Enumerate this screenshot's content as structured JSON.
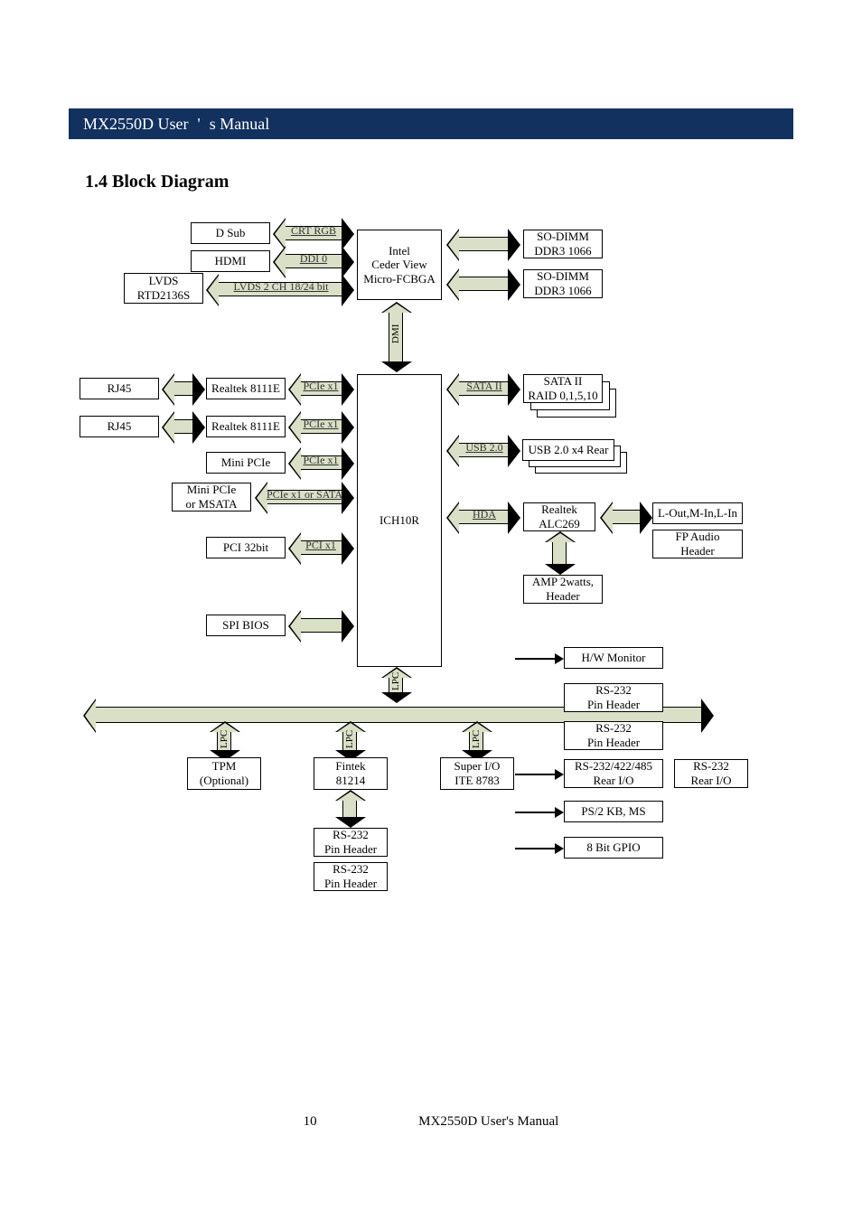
{
  "title_bar": {
    "left": "MX2550D User",
    "sep": "'",
    "right": "s Manual"
  },
  "heading": "1.4 Block Diagram",
  "footer": "MX2550D User's Manual",
  "cpu": {
    "l1": "Intel",
    "l2": "Ceder View",
    "l3": "Micro-FCBGA"
  },
  "display": {
    "dsub": "D Sub",
    "hdmi": "HDMI",
    "lvds": {
      "l1": "LVDS",
      "l2": "RTD2136S"
    },
    "crt": "CRT RGB",
    "ddi": "DDI 0",
    "lvds_bus": "LVDS 2 CH 18/24 bit"
  },
  "mem": {
    "sodimm": "SO-DIMM",
    "ddr": "DDR3 1066"
  },
  "dmi": "DMI",
  "pch": "ICH10R",
  "left_col": {
    "rj45": "RJ45",
    "realtek": "Realtek 8111E",
    "mini_pcie": "Mini PCIe",
    "mini_pcie_msata": {
      "l1": "Mini PCIe",
      "l2": "or MSATA"
    },
    "pci32": "PCI 32bit",
    "spi": "SPI BIOS",
    "pcie_x1": "PCIe x1",
    "pcie_sata": "PCIe x1 or SATA",
    "pci_x1": "PCI x1"
  },
  "right_col": {
    "sata": {
      "l1": "SATA II",
      "l2": "RAID 0,1,5,10"
    },
    "sata_bus": "SATA II",
    "usb": "USB 2.0 x4 Rear",
    "usb_bus": "USB 2.0",
    "hda": "HDA",
    "codec": {
      "l1": "Realtek",
      "l2": "ALC269"
    },
    "audio_jacks": "L-Out,M-In,L-In",
    "fp_audio": {
      "l1": "FP Audio",
      "l2": "Header"
    },
    "amp": {
      "l1": "AMP 2watts,",
      "l2": "Header"
    }
  },
  "lpc": "LPC",
  "bottom": {
    "tpm": {
      "l1": "TPM",
      "l2": "(Optional)"
    },
    "fintek": {
      "l1": "Fintek",
      "l2": "81214"
    },
    "sio": {
      "l1": "Super I/O",
      "l2": "ITE 8783"
    },
    "rs232_ph": {
      "l1": "RS-232",
      "l2": "Pin Header"
    },
    "hw_mon": "H/W Monitor",
    "rs232_422_485": {
      "l1": "RS-232/422/485",
      "l2": "Rear I/O"
    },
    "rs232_rear": {
      "l1": "RS-232",
      "l2": "Rear I/O"
    },
    "ps2": "PS/2 KB, MS",
    "gpio": "8 Bit GPIO"
  },
  "page_num": "10"
}
